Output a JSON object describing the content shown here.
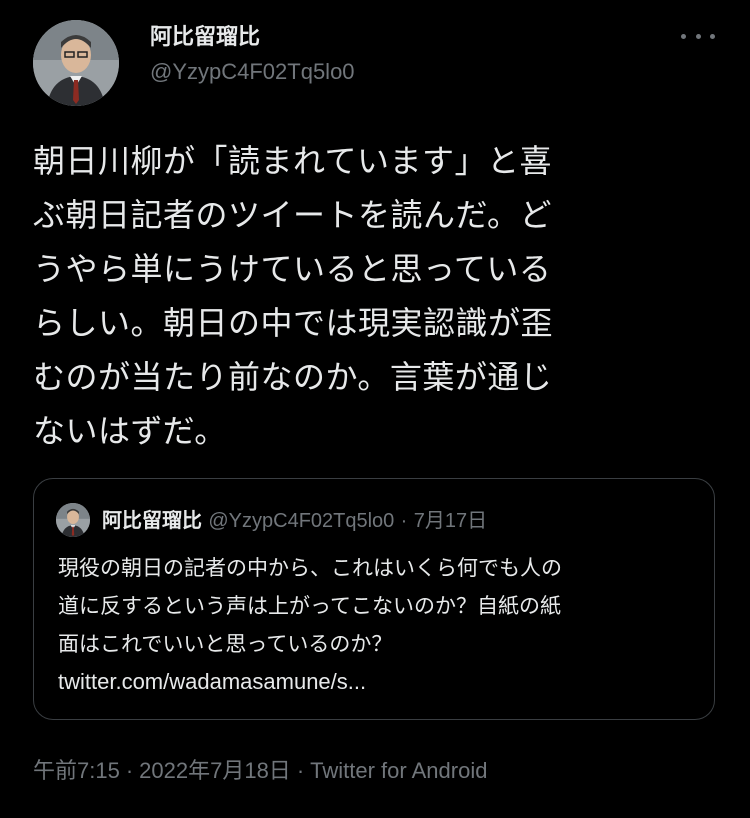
{
  "tweet": {
    "author": {
      "display_name": "阿比留瑠比",
      "handle": "@YzypC4F02Tq5lo0"
    },
    "text_lines": [
      "朝日川柳が「読まれています」と喜",
      "ぶ朝日記者のツイートを読んだ。ど",
      "うやら単にうけていると思っている",
      "らしい。朝日の中では現実認識が歪",
      "むのが当たり前なのか。言葉が通じ",
      "ないはずだ。"
    ],
    "quoted": {
      "display_name": "阿比留瑠比",
      "handle": "@YzypC4F02Tq5lo0",
      "separator": "·",
      "date": "7月17日",
      "text_lines": [
        "現役の朝日の記者の中から、これはいくら何でも人の",
        "道に反するという声は上がってこないのか？自紙の紙",
        "面はこれでいいと思っているのか？"
      ],
      "link": "twitter.com/wadamasamune/s..."
    },
    "meta": {
      "time": "午前7:15",
      "separator": "·",
      "date": "2022年7月18日",
      "source": "Twitter for Android"
    }
  },
  "icons": {
    "more": "more-horizontal-icon"
  },
  "colors": {
    "background": "#000000",
    "text_primary": "#e7e9ea",
    "text_secondary": "#71767b",
    "border": "#3a3e42"
  }
}
